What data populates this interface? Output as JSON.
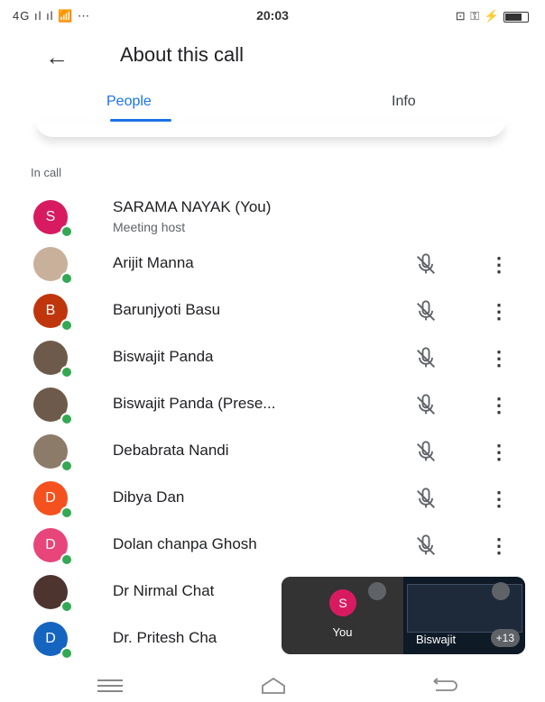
{
  "status_bar": {
    "left": "4G ıl ıl 📶 ⋯",
    "time": "20:03",
    "right": "⊡ ⚿ ⚡"
  },
  "header": {
    "title": "About this call"
  },
  "tabs": [
    {
      "label": "People"
    },
    {
      "label": "Info"
    }
  ],
  "section_label": "In call",
  "participants": [
    {
      "name": "SARAMA NAYAK (You)",
      "subtitle": "Meeting host",
      "initial": "S",
      "color": "#d81b60"
    },
    {
      "name": "Arijit Manna",
      "initial": "",
      "color": "#c9b09a"
    },
    {
      "name": "Barunjyoti Basu",
      "initial": "B",
      "color": "#bf360c"
    },
    {
      "name": "Biswajit Panda",
      "initial": "",
      "color": "#6d5a4a"
    },
    {
      "name": "Biswajit Panda (Prese...",
      "initial": "",
      "color": "#6d5a4a"
    },
    {
      "name": "Debabrata Nandi",
      "initial": "",
      "color": "#8d7b6a"
    },
    {
      "name": "Dibya Dan",
      "initial": "D",
      "color": "#f4511e"
    },
    {
      "name": "Dolan chanpa Ghosh",
      "initial": "D",
      "color": "#e8457a"
    },
    {
      "name": "Dr Nirmal Chat",
      "initial": "",
      "color": "#4e342e"
    },
    {
      "name": "Dr. Pritesh Cha",
      "initial": "D",
      "color": "#1565c0"
    }
  ],
  "pip": {
    "self_initial": "S",
    "self_label": "You",
    "other_label": "Biswajit",
    "count": "+13"
  },
  "colors": {
    "accent": "#1a73e8",
    "online": "#34a853"
  }
}
